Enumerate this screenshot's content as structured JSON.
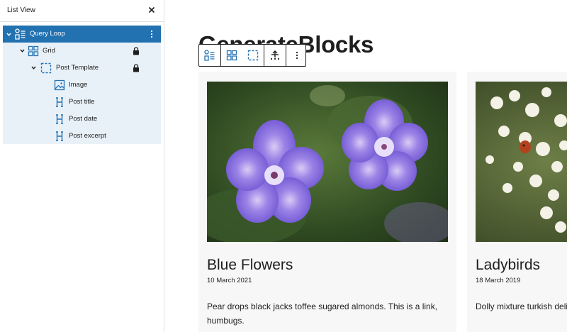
{
  "sidebar": {
    "title": "List View",
    "close_icon": "close-icon",
    "tree": [
      {
        "label": "Query Loop",
        "icon": "query-loop-icon",
        "selected": true,
        "expanded": true,
        "locked": false
      },
      {
        "label": "Grid",
        "icon": "grid-icon",
        "selected": false,
        "expanded": true,
        "locked": true
      },
      {
        "label": "Post Template",
        "icon": "post-template-icon",
        "selected": false,
        "expanded": true,
        "locked": true
      },
      {
        "label": "Image",
        "icon": "image-icon",
        "selected": false,
        "locked": false
      },
      {
        "label": "Post title",
        "icon": "heading-icon",
        "selected": false,
        "locked": false
      },
      {
        "label": "Post date",
        "icon": "heading-icon",
        "selected": false,
        "locked": false
      },
      {
        "label": "Post excerpt",
        "icon": "heading-icon",
        "selected": false,
        "locked": false
      }
    ]
  },
  "canvas": {
    "page_heading": "GenerateBlocks",
    "toolbar": {
      "buttons": [
        "query-loop-icon",
        "grid-icon",
        "select-parent-icon",
        "move-icon",
        "more-options-icon"
      ]
    },
    "posts": [
      {
        "title": "Blue Flowers",
        "date": "10 March 2021",
        "excerpt": "Pear drops black jacks toffee sugared almonds. This is a link, humbugs."
      },
      {
        "title": "Ladybirds",
        "date": "18 March 2019",
        "excerpt": "Dolly mixture turkish delight drops chocolate limes,"
      }
    ]
  },
  "colors": {
    "accent": "#2271b1",
    "tree_bg": "#e9f1f8",
    "card_bg": "#f7f7f7",
    "text": "#1e1e1e"
  }
}
